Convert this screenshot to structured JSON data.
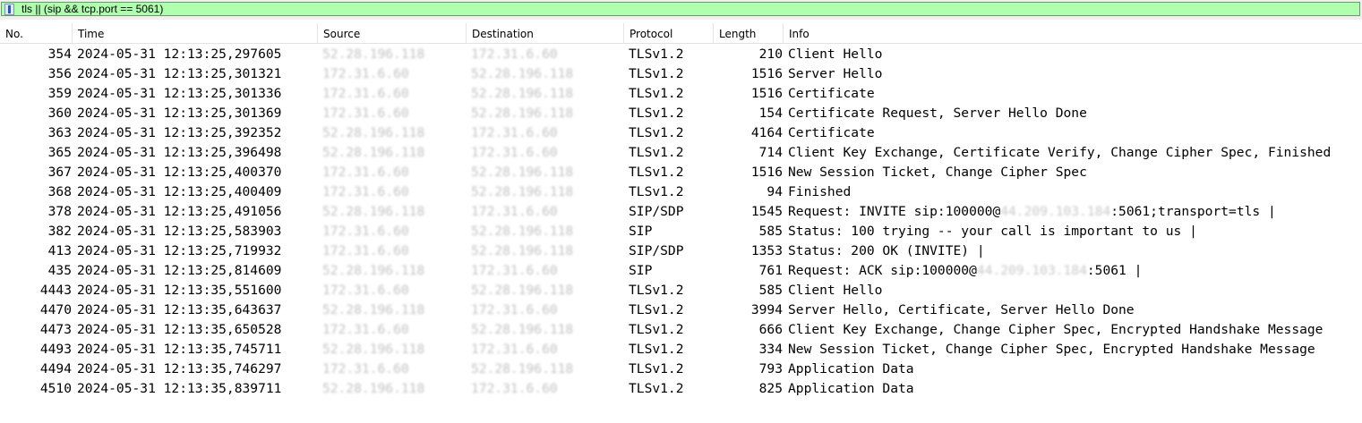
{
  "filter": {
    "text": "tls || (sip && tcp.port == 5061)"
  },
  "columns": [
    "No.",
    "Time",
    "Source",
    "Destination",
    "Protocol",
    "Length",
    "Info"
  ],
  "packets": [
    {
      "no": "354",
      "time": "2024-05-31 12:13:25,297605",
      "source": "52.28.196.118",
      "destination": "172.31.6.60",
      "protocol": "TLSv1.2",
      "length": "210",
      "info": "Client Hello"
    },
    {
      "no": "356",
      "time": "2024-05-31 12:13:25,301321",
      "source": "172.31.6.60",
      "destination": "52.28.196.118",
      "protocol": "TLSv1.2",
      "length": "1516",
      "info": "Server Hello"
    },
    {
      "no": "359",
      "time": "2024-05-31 12:13:25,301336",
      "source": "172.31.6.60",
      "destination": "52.28.196.118",
      "protocol": "TLSv1.2",
      "length": "1516",
      "info": "Certificate"
    },
    {
      "no": "360",
      "time": "2024-05-31 12:13:25,301369",
      "source": "172.31.6.60",
      "destination": "52.28.196.118",
      "protocol": "TLSv1.2",
      "length": "154",
      "info": "Certificate Request, Server Hello Done"
    },
    {
      "no": "363",
      "time": "2024-05-31 12:13:25,392352",
      "source": "52.28.196.118",
      "destination": "172.31.6.60",
      "protocol": "TLSv1.2",
      "length": "4164",
      "info": "Certificate"
    },
    {
      "no": "365",
      "time": "2024-05-31 12:13:25,396498",
      "source": "52.28.196.118",
      "destination": "172.31.6.60",
      "protocol": "TLSv1.2",
      "length": "714",
      "info": "Client Key Exchange, Certificate Verify, Change Cipher Spec, Finished"
    },
    {
      "no": "367",
      "time": "2024-05-31 12:13:25,400370",
      "source": "172.31.6.60",
      "destination": "52.28.196.118",
      "protocol": "TLSv1.2",
      "length": "1516",
      "info": "New Session Ticket, Change Cipher Spec"
    },
    {
      "no": "368",
      "time": "2024-05-31 12:13:25,400409",
      "source": "172.31.6.60",
      "destination": "52.28.196.118",
      "protocol": "TLSv1.2",
      "length": "94",
      "info": "Finished"
    },
    {
      "no": "378",
      "time": "2024-05-31 12:13:25,491056",
      "source": "52.28.196.118",
      "destination": "172.31.6.60",
      "protocol": "SIP/SDP",
      "length": "1545",
      "info": "Request: INVITE sip:100000@",
      "info_blurred": "44.209.103.184",
      "info_after": ":5061;transport=tls |"
    },
    {
      "no": "382",
      "time": "2024-05-31 12:13:25,583903",
      "source": "172.31.6.60",
      "destination": "52.28.196.118",
      "protocol": "SIP",
      "length": "585",
      "info": "Status: 100 trying -- your call is important to us |"
    },
    {
      "no": "413",
      "time": "2024-05-31 12:13:25,719932",
      "source": "172.31.6.60",
      "destination": "52.28.196.118",
      "protocol": "SIP/SDP",
      "length": "1353",
      "info": "Status: 200 OK (INVITE) |"
    },
    {
      "no": "435",
      "time": "2024-05-31 12:13:25,814609",
      "source": "52.28.196.118",
      "destination": "172.31.6.60",
      "protocol": "SIP",
      "length": "761",
      "info": "Request: ACK sip:100000@",
      "info_blurred": "44.209.103.184",
      "info_after": ":5061 |"
    },
    {
      "no": "4443",
      "time": "2024-05-31 12:13:35,551600",
      "source": "172.31.6.60",
      "destination": "52.28.196.118",
      "protocol": "TLSv1.2",
      "length": "585",
      "info": "Client Hello"
    },
    {
      "no": "4470",
      "time": "2024-05-31 12:13:35,643637",
      "source": "52.28.196.118",
      "destination": "172.31.6.60",
      "protocol": "TLSv1.2",
      "length": "3994",
      "info": "Server Hello, Certificate, Server Hello Done"
    },
    {
      "no": "4473",
      "time": "2024-05-31 12:13:35,650528",
      "source": "172.31.6.60",
      "destination": "52.28.196.118",
      "protocol": "TLSv1.2",
      "length": "666",
      "info": "Client Key Exchange, Change Cipher Spec, Encrypted Handshake Message"
    },
    {
      "no": "4493",
      "time": "2024-05-31 12:13:35,745711",
      "source": "52.28.196.118",
      "destination": "172.31.6.60",
      "protocol": "TLSv1.2",
      "length": "334",
      "info": "New Session Ticket, Change Cipher Spec, Encrypted Handshake Message"
    },
    {
      "no": "4494",
      "time": "2024-05-31 12:13:35,746297",
      "source": "172.31.6.60",
      "destination": "52.28.196.118",
      "protocol": "TLSv1.2",
      "length": "793",
      "info": "Application Data"
    },
    {
      "no": "4510",
      "time": "2024-05-31 12:13:35,839711",
      "source": "52.28.196.118",
      "destination": "172.31.6.60",
      "protocol": "TLSv1.2",
      "length": "825",
      "info": "Application Data"
    }
  ]
}
